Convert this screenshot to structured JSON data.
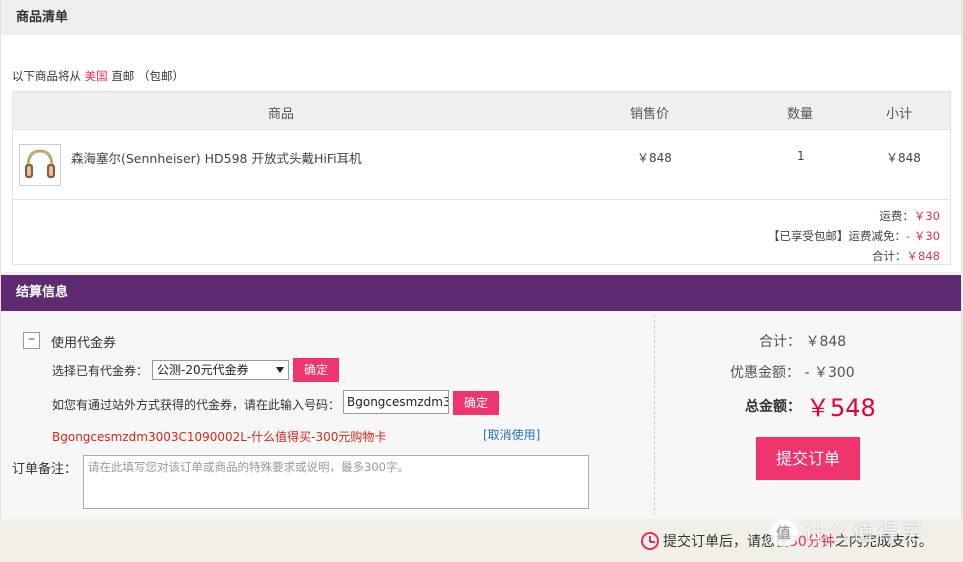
{
  "items_section": {
    "title": "商品清单",
    "ship_prefix": "以下商品将从",
    "ship_country": "美国",
    "ship_suffix": "直邮 （包邮）",
    "columns": [
      "商品",
      "销售价",
      "数量",
      "小计"
    ],
    "rows": [
      {
        "name": "森海塞尔(Sennheiser) HD598 开放式头戴HiFi耳机",
        "price": "￥848",
        "qty": "1",
        "subtotal": "￥848"
      }
    ],
    "shipping_label": "运费：",
    "shipping_value": "￥30",
    "shipping_discount_label": "【已享受包邮】运费减免：",
    "shipping_discount_value": "- ￥30",
    "total_label": "合计：",
    "total_value": "￥848"
  },
  "checkout_section": {
    "title": "结算信息",
    "toggle_symbol": "–",
    "use_coupon_label": "使用代金券",
    "select_coupon_label": "选择已有代金券：",
    "select_value": "公测-20元代金券",
    "confirm_label": "确定",
    "other_coupon_label": "如您有通过站外方式获得的代金券，请在此输入号码：",
    "code_value": "Bgongcesmzdm3003C1090002L",
    "confirm2_label": "确定",
    "applied_code_text": "Bgongcesmzdm3003C1090002L-什么值得买-300元购物卡",
    "cancel_use_label": "[取消使用]",
    "note_label": "订单备注：",
    "note_placeholder": "请在此填写您对该订单或商品的特殊要求或说明，最多300字。"
  },
  "summary": {
    "subtotal_label": "合计：",
    "subtotal_value": "￥848",
    "discount_label": "优惠金额：",
    "discount_value": "- ￥300",
    "total_label": "总金额：",
    "total_value": "￥548",
    "submit_label": "提交订单"
  },
  "footer": {
    "tip_prefix": "提交订单后，请您在",
    "tip_highlight": "30分钟",
    "tip_suffix": "之内完成支付。"
  },
  "watermark": {
    "text": "什么值得买"
  },
  "icons": {
    "clock": "clock-icon",
    "headphones": "headphones-icon",
    "dropdown": "chevron-down-icon"
  },
  "colors": {
    "accent_pink": "#f0356e",
    "header_purple": "#5e2a72",
    "price_red": "#e4003a"
  }
}
